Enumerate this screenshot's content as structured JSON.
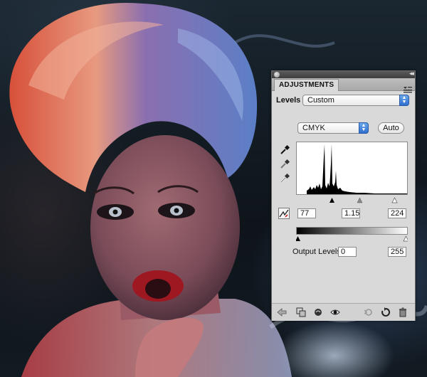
{
  "panel": {
    "tab_label": "ADJUSTMENTS",
    "menu_icon": "panel-menu-icon",
    "collapse_glyph": "◂◂",
    "preset": {
      "label": "Levels",
      "value": "Custom"
    },
    "channel": {
      "value": "CMYK"
    },
    "auto_label": "Auto",
    "input_levels": {
      "black": "77",
      "gamma": "1.15",
      "white": "224"
    },
    "output_levels": {
      "label": "Output Levels:",
      "black": "0",
      "white": "255"
    },
    "eyedroppers": [
      "black-point-eyedropper-icon",
      "gray-point-eyedropper-icon",
      "white-point-eyedropper-icon"
    ],
    "footer_icons": [
      "return-arrow-icon",
      "clip-to-layer-icon",
      "layer-visibility-icon",
      "eye-icon",
      "previous-state-icon",
      "reset-icon",
      "trash-icon"
    ],
    "colors": {
      "panel_bg": "#d9d9d9",
      "select_arrow_blue": "#2f6fcf",
      "titlebar": "#4a4a4a"
    }
  },
  "histogram_data": {
    "input_black": 77,
    "input_gamma": 1.15,
    "input_white": 224,
    "output_black": 0,
    "output_white": 255
  }
}
